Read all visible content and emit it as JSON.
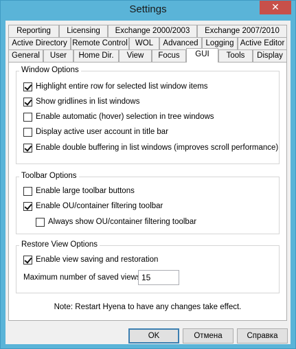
{
  "window": {
    "title": "Settings",
    "close_glyph": "✕"
  },
  "tabs": {
    "row1": [
      "Reporting",
      "Licensing",
      "Exchange 2000/2003",
      "Exchange 2007/2010"
    ],
    "row2": [
      "Active Directory",
      "Remote Control",
      "WOL",
      "Advanced",
      "Logging",
      "Active Editor"
    ],
    "row3": [
      "General",
      "User",
      "Home Dir.",
      "View",
      "Focus",
      "GUI",
      "Tools",
      "Display"
    ],
    "active": "GUI"
  },
  "window_options": {
    "title": "Window Options",
    "items": [
      {
        "label": "Highlight entire row for selected list window items",
        "checked": true
      },
      {
        "label": "Show gridlines in list windows",
        "checked": true
      },
      {
        "label": "Enable automatic (hover) selection in tree windows",
        "checked": false
      },
      {
        "label": "Display active user account in title bar",
        "checked": false
      },
      {
        "label": "Enable double buffering in list windows (improves scroll performance)",
        "checked": true
      }
    ]
  },
  "toolbar_options": {
    "title": "Toolbar Options",
    "items": [
      {
        "label": "Enable large toolbar buttons",
        "checked": false
      },
      {
        "label": "Enable OU/container filtering toolbar",
        "checked": true
      },
      {
        "label": "Always show OU/container filtering toolbar",
        "checked": false
      }
    ]
  },
  "restore_view_options": {
    "title": "Restore View Options",
    "enable_label": "Enable view saving and restoration",
    "enable_checked": true,
    "max_label": "Maximum number of saved views",
    "max_value": "15"
  },
  "note": "Note: Restart Hyena to have any changes take effect.",
  "buttons": {
    "ok": "OK",
    "cancel": "Отмена",
    "help": "Справка"
  }
}
